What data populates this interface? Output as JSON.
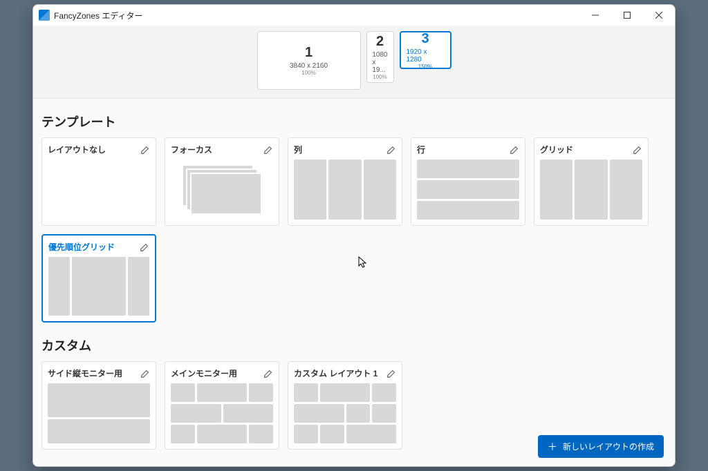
{
  "window": {
    "title": "FancyZones エディター"
  },
  "monitors": [
    {
      "num": "1",
      "res": "3840 x 2160",
      "scale": "100%",
      "selected": false
    },
    {
      "num": "2",
      "res": "1080 x 19...",
      "scale": "100%",
      "selected": false
    },
    {
      "num": "3",
      "res": "1920 x 1280",
      "scale": "150%",
      "selected": true
    }
  ],
  "sections": {
    "templates_title": "テンプレート",
    "custom_title": "カスタム"
  },
  "templates": [
    {
      "name": "レイアウトなし",
      "type": "none",
      "selected": false
    },
    {
      "name": "フォーカス",
      "type": "focus",
      "selected": false
    },
    {
      "name": "列",
      "type": "cols",
      "selected": false
    },
    {
      "name": "行",
      "type": "rows",
      "selected": false
    },
    {
      "name": "グリッド",
      "type": "grid3",
      "selected": false
    },
    {
      "name": "優先順位グリッド",
      "type": "prio",
      "selected": true
    }
  ],
  "custom": [
    {
      "name": "サイド縦モニター用",
      "type": "custom1"
    },
    {
      "name": "メインモニター用",
      "type": "custom2"
    },
    {
      "name": "カスタム レイアウト 1",
      "type": "custom3"
    }
  ],
  "buttons": {
    "new_layout": "新しいレイアウトの作成"
  }
}
